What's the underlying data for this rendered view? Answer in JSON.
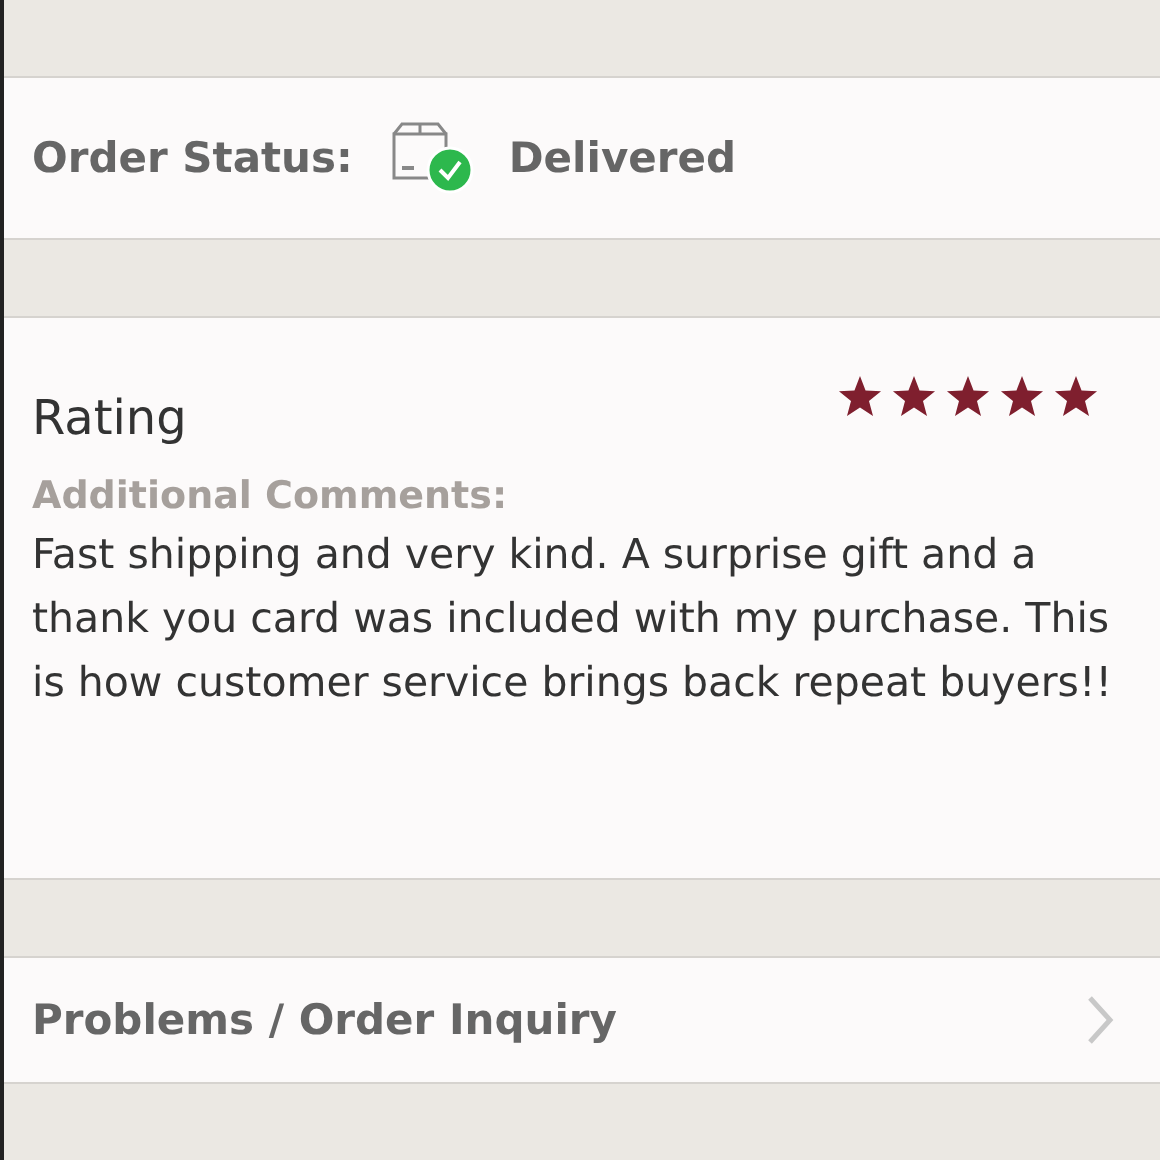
{
  "order_status": {
    "label": "Order Status:",
    "value": "Delivered"
  },
  "rating": {
    "title": "Rating",
    "stars": 5,
    "comments_label": "Additional Comments:",
    "comments": "Fast shipping and very kind. A surprise gift and a thank you card was included with my purchase. This is how customer service brings back repeat buyers!!"
  },
  "inquiry": {
    "label": "Problems / Order Inquiry"
  }
}
